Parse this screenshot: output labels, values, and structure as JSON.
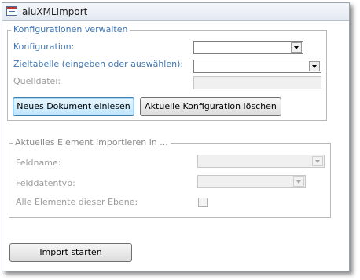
{
  "window": {
    "title": "aiuXMLImport"
  },
  "group_config": {
    "legend": "Konfigurationen verwalten",
    "konfiguration_label": "Konfiguration:",
    "konfiguration_value": "",
    "zieltabelle_label": "Zieltabelle (eingeben oder auswählen):",
    "zieltabelle_value": "",
    "quelldatei_label": "Quelldatei:",
    "quelldatei_value": "",
    "neues_dokument_button": "Neues Dokument einlesen",
    "konfiguration_loeschen_button": "Aktuelle Konfiguration löschen"
  },
  "group_element": {
    "legend": "Aktuelles Element importieren in ...",
    "feldname_label": "Feldname:",
    "feldname_value": "",
    "felddatentyp_label": "Felddatentyp:",
    "felddatentyp_value": "",
    "alle_elemente_label": "Alle Elemente dieser Ebene:",
    "alle_elemente_checked": false
  },
  "footer": {
    "import_button": "Import starten"
  },
  "colors": {
    "label_active": "#3c73b1",
    "label_disabled": "#9c9c9c",
    "focus_button_border": "#3c7fb1"
  }
}
